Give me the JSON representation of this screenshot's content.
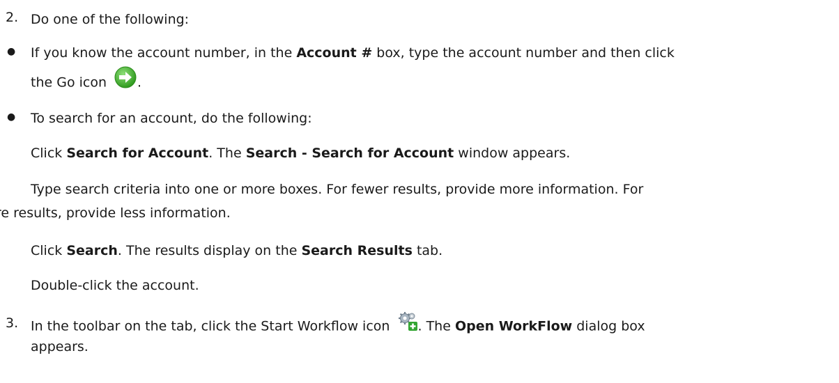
{
  "step2": {
    "number": "2.",
    "text": "Do one of the following:"
  },
  "bullet1": {
    "pre": "If you know the account number, in the ",
    "field": "Account #",
    "post": " box, type the account number and then click",
    "line2_pre": "the Go icon",
    "line2_post": ".",
    "icon": "go-arrow-icon"
  },
  "bullet2": {
    "text": "To search for an account, do the following:"
  },
  "sub1": {
    "pre": "Click ",
    "link": "Search for Account",
    "mid": ". The ",
    "window": "Search - Search for Account",
    "post": " window appears."
  },
  "sub2": {
    "line1": "Type search criteria into one or more boxes. For fewer results, provide more information. For",
    "line2": "re results, provide less information."
  },
  "sub3": {
    "pre": "Click ",
    "button": "Search",
    "mid": ". The results display on the ",
    "tab": "Search Results",
    "post": " tab."
  },
  "sub4": {
    "text": "Double-click the account."
  },
  "step3": {
    "number": "3.",
    "pre": "In the toolbar on the tab, click the Start Workflow icon",
    "mid": ". The ",
    "dialog": "Open WorkFlow",
    "post": " dialog box",
    "line2": "appears.",
    "icon": "start-workflow-icon"
  },
  "colors": {
    "text": "#1a1a1a",
    "go_icon": "#3fae2a",
    "gear_icon": "#8a9aa8",
    "plus_icon": "#33a532"
  }
}
